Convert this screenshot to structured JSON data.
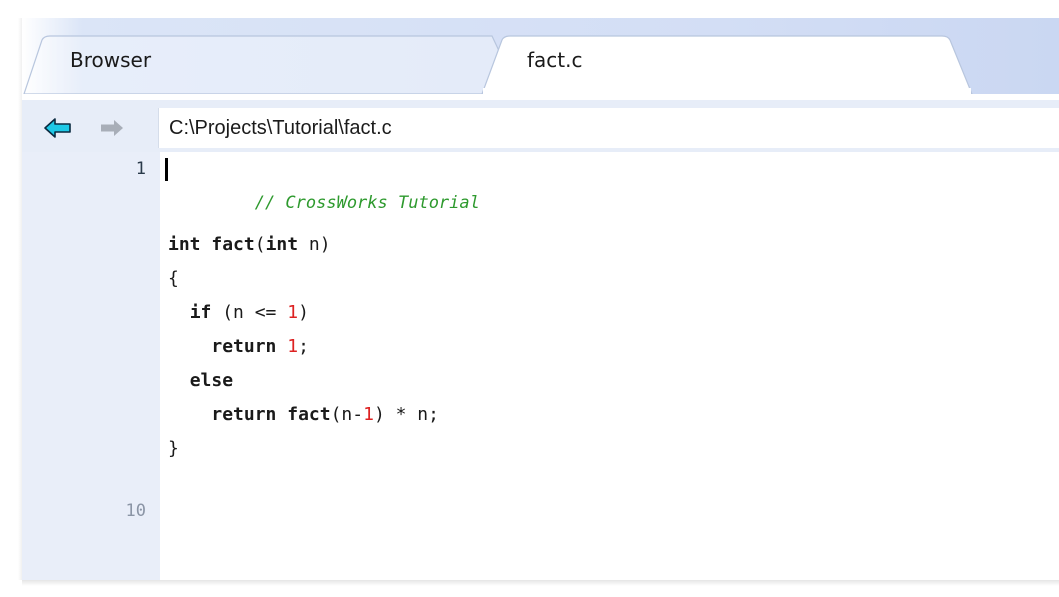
{
  "tabs": [
    {
      "label": "Browser",
      "active": false
    },
    {
      "label": "fact.c",
      "active": true
    }
  ],
  "nav": {
    "back_icon": "back-arrow-icon",
    "forward_icon": "forward-arrow-icon",
    "path": "C:\\Projects\\Tutorial\\fact.c"
  },
  "gutter": {
    "line_1": "1",
    "line_10": "10"
  },
  "code": {
    "l1_comment": "// CrossWorks Tutorial",
    "l3_kw1": "int",
    "l3_fn": "fact",
    "l3_open": "(",
    "l3_kw2": "int",
    "l3_rest": " n)",
    "l4": "{",
    "l5_kw": "if",
    "l5_pre": " (n <= ",
    "l5_num": "1",
    "l5_post": ")",
    "l6_kw": "return",
    "l6_num": "1",
    "l6_post": ";",
    "l7_kw": "else",
    "l8_kw": "return",
    "l8_fn": "fact",
    "l8_pre": "(n-",
    "l8_num": "1",
    "l8_post": ") * n;",
    "l9": "}"
  },
  "colors": {
    "accent_back_arrow": "#1ec8e6",
    "forward_arrow": "#a8aeb8",
    "number": "#dd2222",
    "comment": "#2e9a2e",
    "gutter_bg": "#e9eef9"
  }
}
